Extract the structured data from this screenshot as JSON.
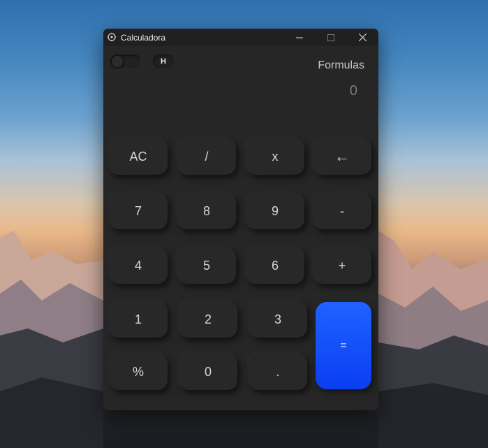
{
  "window": {
    "title": "Calculadora"
  },
  "header": {
    "history_label": "H",
    "formulas_label": "Formulas",
    "display_value": "0"
  },
  "keys": {
    "ac": "AC",
    "divide": "/",
    "multiply": "x",
    "backspace": "←",
    "seven": "7",
    "eight": "8",
    "nine": "9",
    "minus": "-",
    "four": "4",
    "five": "5",
    "six": "6",
    "plus": "+",
    "one": "1",
    "two": "2",
    "three": "3",
    "equals": "=",
    "percent": "%",
    "zero": "0",
    "decimal": "."
  },
  "colors": {
    "window_bg": "#262626",
    "titlebar_bg": "#202020",
    "key_bg": "#282828",
    "accent": "#1f63ff"
  }
}
